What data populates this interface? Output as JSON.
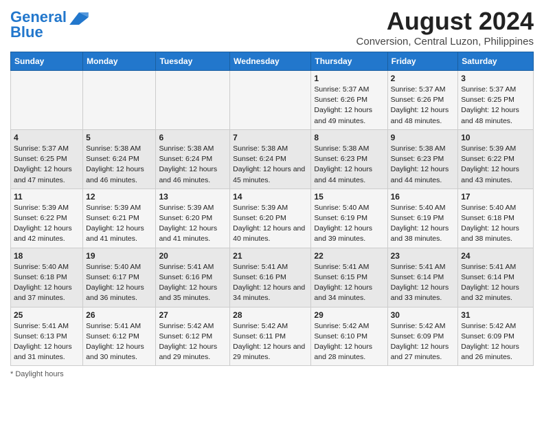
{
  "header": {
    "logo_line1": "General",
    "logo_line2": "Blue",
    "main_title": "August 2024",
    "subtitle": "Conversion, Central Luzon, Philippines"
  },
  "days_of_week": [
    "Sunday",
    "Monday",
    "Tuesday",
    "Wednesday",
    "Thursday",
    "Friday",
    "Saturday"
  ],
  "weeks": [
    [
      {
        "day": "",
        "info": ""
      },
      {
        "day": "",
        "info": ""
      },
      {
        "day": "",
        "info": ""
      },
      {
        "day": "",
        "info": ""
      },
      {
        "day": "1",
        "info": "Sunrise: 5:37 AM\nSunset: 6:26 PM\nDaylight: 12 hours and 49 minutes."
      },
      {
        "day": "2",
        "info": "Sunrise: 5:37 AM\nSunset: 6:26 PM\nDaylight: 12 hours and 48 minutes."
      },
      {
        "day": "3",
        "info": "Sunrise: 5:37 AM\nSunset: 6:25 PM\nDaylight: 12 hours and 48 minutes."
      }
    ],
    [
      {
        "day": "4",
        "info": "Sunrise: 5:37 AM\nSunset: 6:25 PM\nDaylight: 12 hours and 47 minutes."
      },
      {
        "day": "5",
        "info": "Sunrise: 5:38 AM\nSunset: 6:24 PM\nDaylight: 12 hours and 46 minutes."
      },
      {
        "day": "6",
        "info": "Sunrise: 5:38 AM\nSunset: 6:24 PM\nDaylight: 12 hours and 46 minutes."
      },
      {
        "day": "7",
        "info": "Sunrise: 5:38 AM\nSunset: 6:24 PM\nDaylight: 12 hours and 45 minutes."
      },
      {
        "day": "8",
        "info": "Sunrise: 5:38 AM\nSunset: 6:23 PM\nDaylight: 12 hours and 44 minutes."
      },
      {
        "day": "9",
        "info": "Sunrise: 5:38 AM\nSunset: 6:23 PM\nDaylight: 12 hours and 44 minutes."
      },
      {
        "day": "10",
        "info": "Sunrise: 5:39 AM\nSunset: 6:22 PM\nDaylight: 12 hours and 43 minutes."
      }
    ],
    [
      {
        "day": "11",
        "info": "Sunrise: 5:39 AM\nSunset: 6:22 PM\nDaylight: 12 hours and 42 minutes."
      },
      {
        "day": "12",
        "info": "Sunrise: 5:39 AM\nSunset: 6:21 PM\nDaylight: 12 hours and 41 minutes."
      },
      {
        "day": "13",
        "info": "Sunrise: 5:39 AM\nSunset: 6:20 PM\nDaylight: 12 hours and 41 minutes."
      },
      {
        "day": "14",
        "info": "Sunrise: 5:39 AM\nSunset: 6:20 PM\nDaylight: 12 hours and 40 minutes."
      },
      {
        "day": "15",
        "info": "Sunrise: 5:40 AM\nSunset: 6:19 PM\nDaylight: 12 hours and 39 minutes."
      },
      {
        "day": "16",
        "info": "Sunrise: 5:40 AM\nSunset: 6:19 PM\nDaylight: 12 hours and 38 minutes."
      },
      {
        "day": "17",
        "info": "Sunrise: 5:40 AM\nSunset: 6:18 PM\nDaylight: 12 hours and 38 minutes."
      }
    ],
    [
      {
        "day": "18",
        "info": "Sunrise: 5:40 AM\nSunset: 6:18 PM\nDaylight: 12 hours and 37 minutes."
      },
      {
        "day": "19",
        "info": "Sunrise: 5:40 AM\nSunset: 6:17 PM\nDaylight: 12 hours and 36 minutes."
      },
      {
        "day": "20",
        "info": "Sunrise: 5:41 AM\nSunset: 6:16 PM\nDaylight: 12 hours and 35 minutes."
      },
      {
        "day": "21",
        "info": "Sunrise: 5:41 AM\nSunset: 6:16 PM\nDaylight: 12 hours and 34 minutes."
      },
      {
        "day": "22",
        "info": "Sunrise: 5:41 AM\nSunset: 6:15 PM\nDaylight: 12 hours and 34 minutes."
      },
      {
        "day": "23",
        "info": "Sunrise: 5:41 AM\nSunset: 6:14 PM\nDaylight: 12 hours and 33 minutes."
      },
      {
        "day": "24",
        "info": "Sunrise: 5:41 AM\nSunset: 6:14 PM\nDaylight: 12 hours and 32 minutes."
      }
    ],
    [
      {
        "day": "25",
        "info": "Sunrise: 5:41 AM\nSunset: 6:13 PM\nDaylight: 12 hours and 31 minutes."
      },
      {
        "day": "26",
        "info": "Sunrise: 5:41 AM\nSunset: 6:12 PM\nDaylight: 12 hours and 30 minutes."
      },
      {
        "day": "27",
        "info": "Sunrise: 5:42 AM\nSunset: 6:12 PM\nDaylight: 12 hours and 29 minutes."
      },
      {
        "day": "28",
        "info": "Sunrise: 5:42 AM\nSunset: 6:11 PM\nDaylight: 12 hours and 29 minutes."
      },
      {
        "day": "29",
        "info": "Sunrise: 5:42 AM\nSunset: 6:10 PM\nDaylight: 12 hours and 28 minutes."
      },
      {
        "day": "30",
        "info": "Sunrise: 5:42 AM\nSunset: 6:09 PM\nDaylight: 12 hours and 27 minutes."
      },
      {
        "day": "31",
        "info": "Sunrise: 5:42 AM\nSunset: 6:09 PM\nDaylight: 12 hours and 26 minutes."
      }
    ]
  ],
  "footer": {
    "note": "Daylight hours"
  }
}
